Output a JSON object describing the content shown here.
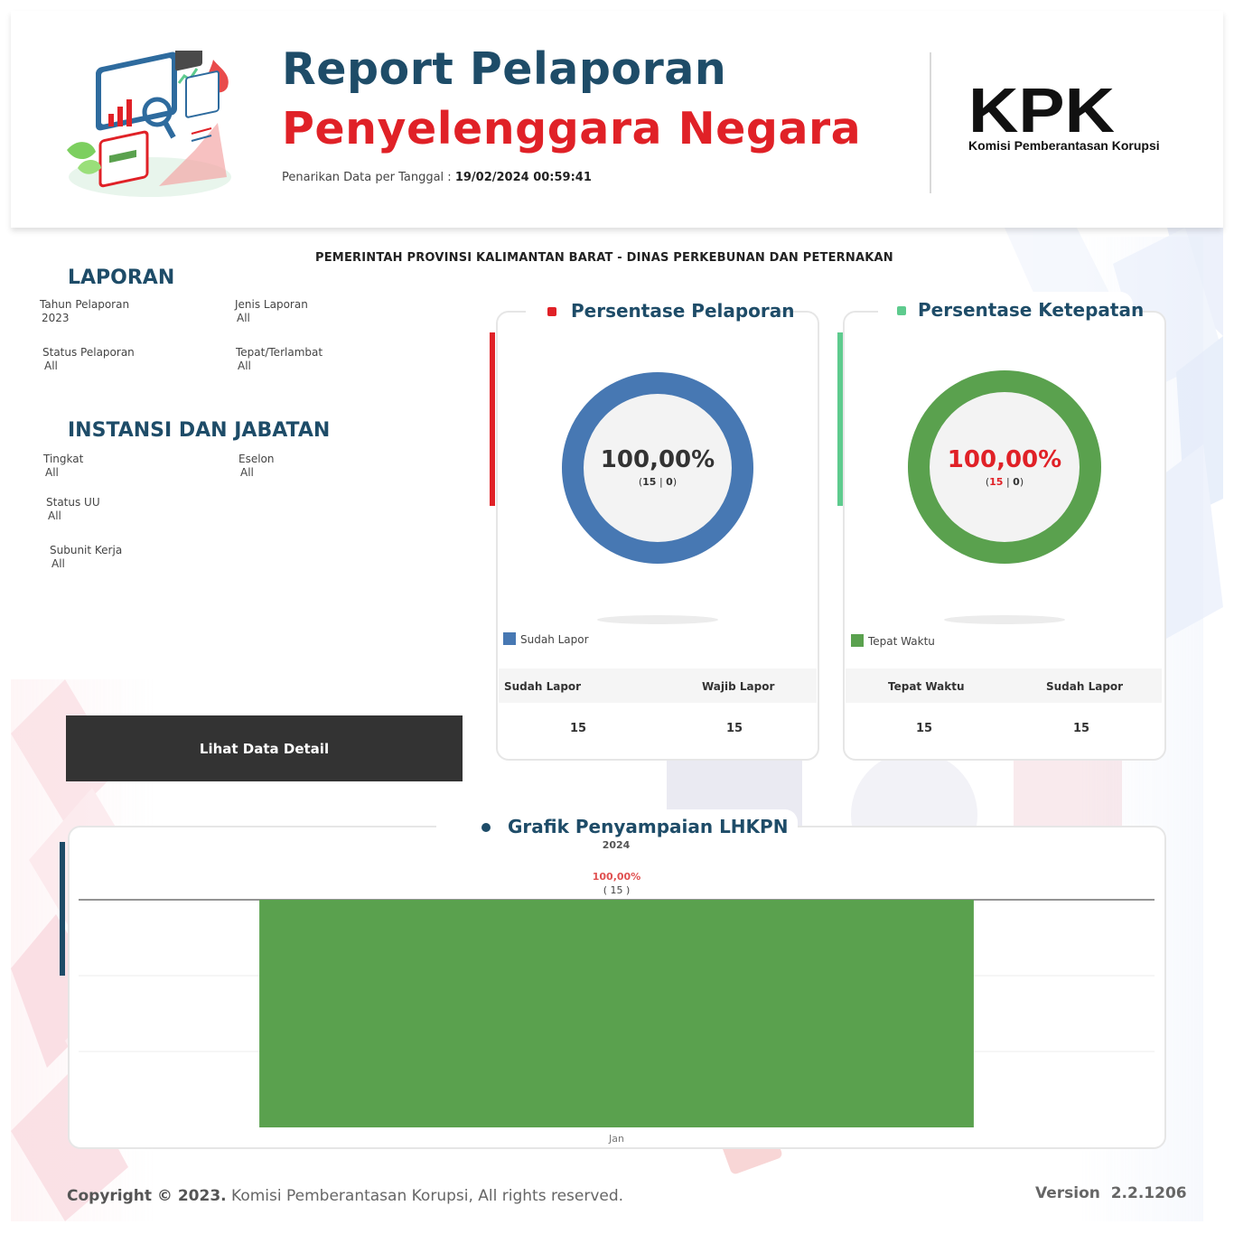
{
  "header": {
    "title_line1": "Report Pelaporan",
    "title_line2": "Penyelenggara Negara",
    "pull_date_label": "Penarikan Data per Tanggal :",
    "pull_date_value": "19/02/2024 00:59:41",
    "logo_text": "KPK",
    "logo_subtitle": "Komisi Pemberantasan Korupsi"
  },
  "agency": "PEMERINTAH PROVINSI KALIMANTAN BARAT - DINAS PERKEBUNAN DAN PETERNAKAN",
  "laporan": {
    "title": "LAPORAN",
    "filters": [
      {
        "label": "Tahun Pelaporan",
        "value": "2023"
      },
      {
        "label": "Jenis Laporan",
        "value": "All"
      },
      {
        "label": "Status Pelaporan",
        "value": "All"
      },
      {
        "label": "Tepat/Terlambat",
        "value": "All"
      }
    ]
  },
  "instansi": {
    "title": "INSTANSI DAN JABATAN",
    "filters": [
      {
        "label": "Tingkat",
        "value": "All"
      },
      {
        "label": "Eselon",
        "value": "All"
      },
      {
        "label": "Status UU",
        "value": "All"
      },
      {
        "label": "Subunit Kerja",
        "value": "All"
      }
    ]
  },
  "detail_button": "Lihat Data Detail",
  "card_pelaporan": {
    "title": "Persentase Pelaporan",
    "percent": "100,00%",
    "sub_open": "(",
    "sub_a": "15",
    "sub_sep": " | ",
    "sub_b": "0",
    "sub_close": ")",
    "fraction": 1.0,
    "legend": "Sudah Lapor",
    "col1_label": "Sudah Lapor",
    "col2_label": "Wajib Lapor",
    "col1_value": "15",
    "col2_value": "15",
    "accent": "#e02127",
    "ring_color": "#4778b3"
  },
  "card_ketepatan": {
    "title": "Persentase Ketepatan",
    "percent": "100,00%",
    "sub_open": "(",
    "sub_a": "15",
    "sub_sep": " | ",
    "sub_b": "0",
    "sub_close": ")",
    "fraction": 1.0,
    "legend": "Tepat Waktu",
    "col1_label": "Tepat Waktu",
    "col2_label": "Sudah Lapor",
    "col1_value": "15",
    "col2_value": "15",
    "accent": "#5ecb8e",
    "ring_color": "#5aa14e"
  },
  "grafik": {
    "title": "Grafik Penyampaian LHKPN",
    "subtitle": "2024"
  },
  "chart_data": {
    "type": "bar",
    "categories": [
      "Jan"
    ],
    "values": [
      100
    ],
    "counts": [
      15
    ],
    "value_labels": [
      "100,00%"
    ],
    "count_labels": [
      "( 15 )"
    ],
    "ylim": [
      0,
      100
    ],
    "grid": true,
    "color": "#5aa14e"
  },
  "footer": {
    "copyright_bold": "Copyright © 2023.",
    "copyright_rest": " Komisi Pemberantasan Korupsi, All rights reserved.",
    "version_label": "Version",
    "version_value": "2.2.1206"
  }
}
